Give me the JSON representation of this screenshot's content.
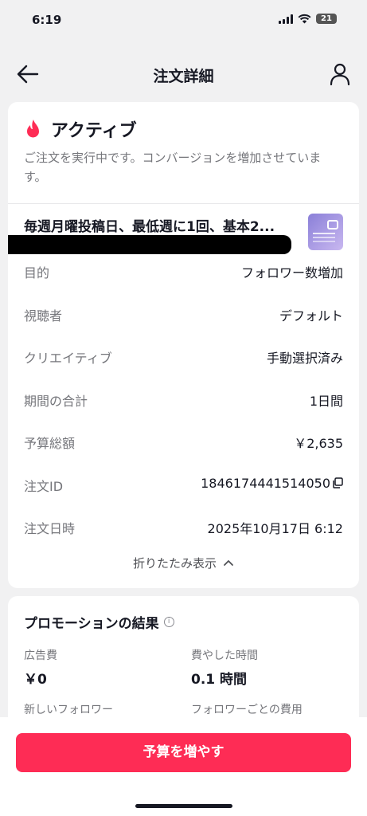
{
  "status_bar": {
    "time": "6:19",
    "battery": "21"
  },
  "nav": {
    "title": "注文詳細"
  },
  "order_status": {
    "title": "アクティブ",
    "description": "ご注文を実行中です。コンバージョンを増加させています。"
  },
  "video": {
    "title": "毎週月曜投稿日、最低週に1回、基本2..."
  },
  "details": [
    {
      "label": "目的",
      "value": "フォロワー数増加"
    },
    {
      "label": "視聴者",
      "value": "デフォルト"
    },
    {
      "label": "クリエイティブ",
      "value": "手動選択済み"
    },
    {
      "label": "期間の合計",
      "value": "1日間"
    },
    {
      "label": "予算総額",
      "value": "￥2,635"
    },
    {
      "label": "注文ID",
      "value": "1846174441514050"
    },
    {
      "label": "注文日時",
      "value": "2025年10月17日 6:12"
    }
  ],
  "collapse_label": "折りたたみ表示",
  "results": {
    "title": "プロモーションの結果",
    "metrics": [
      {
        "label": "広告費",
        "value": "￥0"
      },
      {
        "label": "費やした時間",
        "value": "0.1 時間"
      },
      {
        "label": "新しいフォロワー",
        "value": ""
      },
      {
        "label": "フォロワーごとの費用",
        "value": ""
      }
    ]
  },
  "primary_action": {
    "label": "予算を増やす"
  },
  "colors": {
    "accent": "#fe2c55",
    "flame": "#fe2c55"
  }
}
